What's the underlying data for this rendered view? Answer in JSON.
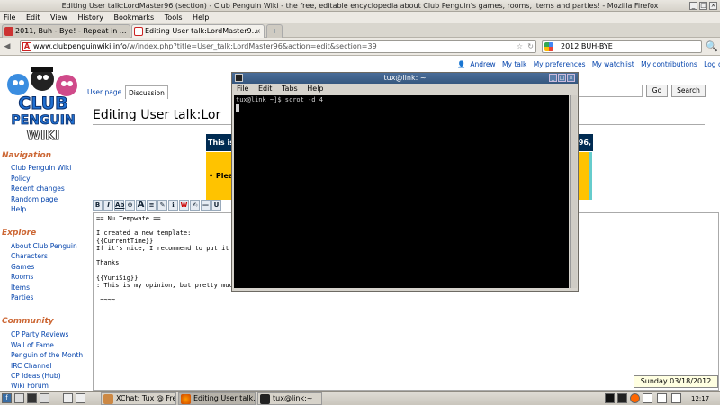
{
  "window": {
    "title": "Editing User talk:LordMaster96 (section) - Club Penguin Wiki - the free, editable encyclopedia about Club Penguin's games, rooms, items and parties! - Mozilla Firefox",
    "minimize": "_",
    "maximize": "□",
    "close": "×"
  },
  "menu": [
    "File",
    "Edit",
    "View",
    "History",
    "Bookmarks",
    "Tools",
    "Help"
  ],
  "tabs": [
    {
      "label": "2011, Buh - Bye! - Repeat in ...",
      "active": false
    },
    {
      "label": "Editing User talk:LordMaster9...",
      "active": true
    }
  ],
  "new_tab": "+",
  "tab_close": "×",
  "nav": {
    "back": "◀",
    "forward": "▶",
    "url_domain": "www.clubpenguinwiki.info",
    "url_path": "/w/index.php?title=User_talk:LordMaster96&action=edit&section=39",
    "star": "☆",
    "reload": "↻",
    "search_value": "2012 BUH-BYE",
    "search_go": "🔍"
  },
  "wiki": {
    "logo_line1": "CLUB",
    "logo_line2": "PENGUIN",
    "logo_line3": "WIKI",
    "personal": [
      "Andrew",
      "My talk",
      "My preferences",
      "My watchlist",
      "My contributions",
      "Log out"
    ],
    "page_tabs": [
      "User page",
      "Discussion"
    ],
    "search_go": "Go",
    "search_btn": "Search",
    "heading": "Editing User talk:Lor",
    "notice1": "This is",
    "notice1_right": "96,",
    "notice2": "• Plea",
    "sidebar": {
      "navigation_head": "Navigation",
      "navigation": [
        "Club Penguin Wiki",
        "Policy",
        "Recent changes",
        "Random page",
        "Help"
      ],
      "explore_head": "Explore",
      "explore": [
        "About Club Penguin",
        "Characters",
        "Games",
        "Rooms",
        "Items",
        "Parties"
      ],
      "community_head": "Community",
      "community": [
        "CP Party Reviews",
        "Wall of Fame",
        "Penguin of the Month",
        "IRC Channel",
        "CP Ideas (Hub)",
        "Wiki Forum"
      ]
    },
    "toolbar": [
      "B",
      "I",
      "Ab",
      "⊕",
      "A",
      "≡",
      "✎",
      "ℹ",
      "W",
      "✍",
      "—",
      "U"
    ],
    "editor_text": "== Nu Tempwate ==\n\nI created a new template:\n{{CurrentTime}}\nIf it's nice, I recommend to put it o\n\nThanks!\n\n{{YuriSig}}\n: This is my opinion, but pretty much\n\n ~~~~",
    "date_tooltip": "Sunday 03/18/2012"
  },
  "terminal": {
    "title": "tux@link: ~",
    "menu": [
      "File",
      "Edit",
      "Tabs",
      "Help"
    ],
    "prompt": "tux@link ~]$ scrot -d 4"
  },
  "taskbar": {
    "tasks": [
      {
        "label": "XChat: Tux @ Fre...",
        "active": false
      },
      {
        "label": "Editing User talk...",
        "active": true
      },
      {
        "label": "tux@link:~",
        "active": false
      }
    ],
    "clock": "12:17"
  }
}
